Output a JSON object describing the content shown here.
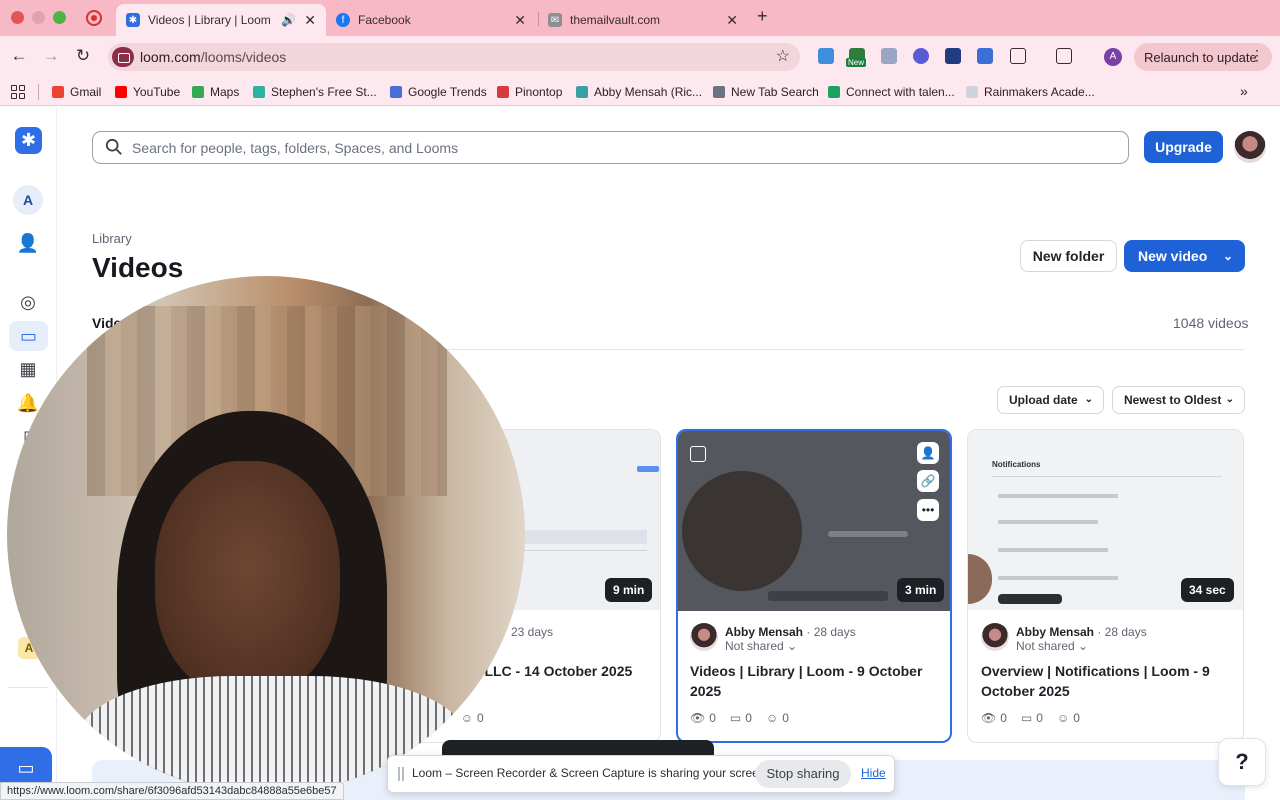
{
  "browser": {
    "tabs": [
      {
        "title": "Videos | Library | Loom",
        "active": true
      },
      {
        "title": "Facebook",
        "active": false
      },
      {
        "title": "themailvault.com",
        "active": false
      }
    ],
    "url_host": "loom.com",
    "url_path": "/looms/videos",
    "relaunch_label": "Relaunch to update",
    "profile_letter": "A",
    "bookmarks": [
      "Gmail",
      "YouTube",
      "Maps",
      "Stephen's Free St...",
      "Google Trends",
      "Pinontop",
      "Abby Mensah (Ric...",
      "New Tab Search",
      "Connect with talen...",
      "Rainmakers Acade..."
    ],
    "status_url": "https://www.loom.com/share/6f3096afd53143dabc84888a55e6be57",
    "extension_badge": "New"
  },
  "sidebar": {
    "workspace_letter": "A",
    "bottom_letter": "A"
  },
  "search": {
    "placeholder": "Search for people, tags, folders, Spaces, and Looms"
  },
  "header": {
    "upgrade_label": "Upgrade"
  },
  "library": {
    "breadcrumb": "Library",
    "title": "Videos",
    "new_folder_label": "New folder",
    "new_video_label": "New video",
    "tab_label": "Vide",
    "video_count": "1048 videos",
    "sort_field": "Upload date",
    "sort_order": "Newest to Oldest"
  },
  "cards": [
    {
      "duration": "9 min",
      "author": "",
      "when": "23 days",
      "share": "",
      "title": "ily LLC - 14 October 2025",
      "views": "",
      "comments": "0",
      "reactions": "0"
    },
    {
      "duration": "3 min",
      "author": "Abby Mensah",
      "when": "28 days",
      "share": "Not shared",
      "title": "Videos | Library | Loom - 9 October 2025",
      "views": "0",
      "comments": "0",
      "reactions": "0"
    },
    {
      "duration": "34 sec",
      "author": "Abby Mensah",
      "when": "28 days",
      "share": "Not shared",
      "title": "Overview | Notifications | Loom - 9 October 2025",
      "views": "0",
      "comments": "0",
      "reactions": "0"
    }
  ],
  "thumb3_title": "Notifications",
  "share_bar": {
    "message": "Loom – Screen Recorder & Screen Capture is sharing your screen.",
    "stop_label": "Stop sharing",
    "hide_label": "Hide"
  },
  "help_label": "?",
  "colors": {
    "accent": "#1f62d8",
    "chrome": "#f7b9c6",
    "chrome_light": "#fce8ee"
  }
}
